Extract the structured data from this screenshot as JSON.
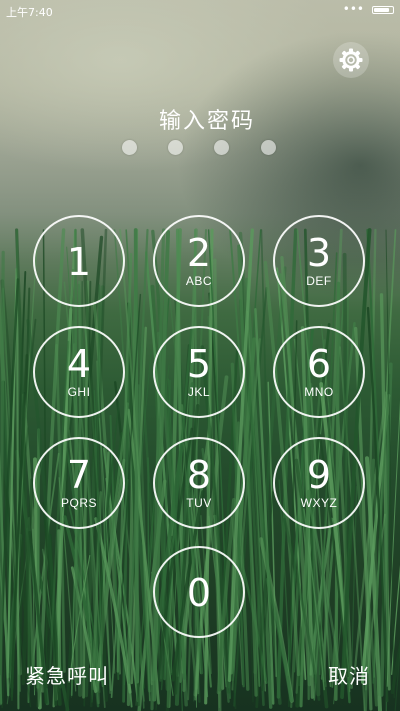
{
  "status_bar": {
    "time": "上午7:40",
    "more_indicator": "•••",
    "battery_icon": "battery-icon",
    "battery_level": 0.85
  },
  "settings": {
    "icon": "gear-icon"
  },
  "prompt": "输入密码",
  "pin": {
    "length": 4,
    "entered": 0
  },
  "keypad": {
    "keys": [
      {
        "digit": "1",
        "letters": ""
      },
      {
        "digit": "2",
        "letters": "ABC"
      },
      {
        "digit": "3",
        "letters": "DEF"
      },
      {
        "digit": "4",
        "letters": "GHI"
      },
      {
        "digit": "5",
        "letters": "JKL"
      },
      {
        "digit": "6",
        "letters": "MNO"
      },
      {
        "digit": "7",
        "letters": "PQRS"
      },
      {
        "digit": "8",
        "letters": "TUV"
      },
      {
        "digit": "9",
        "letters": "WXYZ"
      },
      {
        "digit": "0",
        "letters": ""
      }
    ]
  },
  "bottom": {
    "emergency_label": "紧急呼叫",
    "cancel_label": "取消"
  },
  "colors": {
    "text": "#ffffff",
    "key_border": "#ffffff"
  }
}
